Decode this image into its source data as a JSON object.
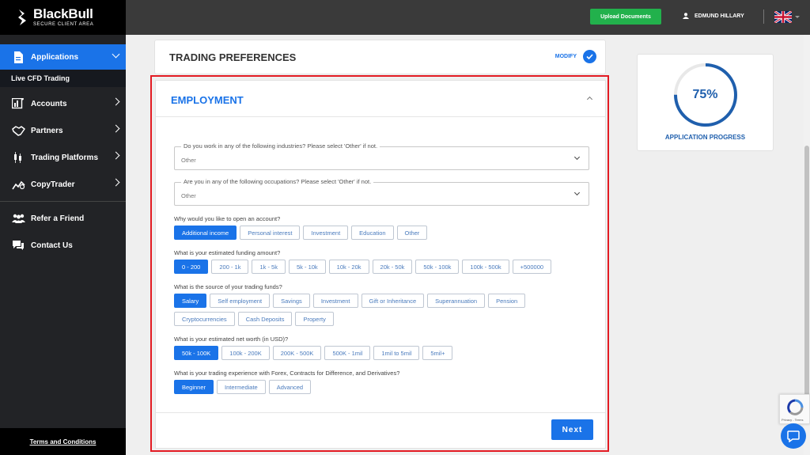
{
  "brand": {
    "name": "BlackBull",
    "tagline": "SECURE CLIENT AREA"
  },
  "sidebar": {
    "items": [
      {
        "label": "Applications",
        "icon": "document-icon"
      },
      {
        "label": "Live CFD Trading"
      },
      {
        "label": "Accounts",
        "icon": "accounts-icon"
      },
      {
        "label": "Partners",
        "icon": "handshake-icon"
      },
      {
        "label": "Trading Platforms",
        "icon": "candlestick-icon"
      },
      {
        "label": "CopyTrader",
        "icon": "copytrader-icon"
      },
      {
        "label": "Refer a Friend",
        "icon": "people-icon"
      },
      {
        "label": "Contact Us",
        "icon": "chat-icon"
      }
    ],
    "footer_link": "Terms and Conditions"
  },
  "topbar": {
    "upload_label": "Upload Documents",
    "user_name": "EDMUND HILLARY",
    "language_flag": "uk-flag-icon"
  },
  "trading_preferences": {
    "title": "TRADING PREFERENCES",
    "modify_label": "MODIFY"
  },
  "progress": {
    "value_label": "75%",
    "fraction": 0.75,
    "label": "APPLICATION PROGRESS",
    "color": "#1f5fad"
  },
  "employment": {
    "title": "EMPLOYMENT",
    "industries": {
      "legend": "Do you work in any of the following industries? Please select 'Other' if not.",
      "value": "Other"
    },
    "occupations": {
      "legend": "Are you in any of the following occupations? Please select 'Other' if not.",
      "value": "Other"
    },
    "reason": {
      "question": "Why would you like to open an account?",
      "options": [
        "Additional income",
        "Personal interest",
        "Investment",
        "Education",
        "Other"
      ],
      "selected": "Additional income"
    },
    "funding": {
      "question": "What is your estimated funding amount?",
      "options": [
        "0 - 200",
        "200 - 1k",
        "1k - 5k",
        "5k - 10k",
        "10k - 20k",
        "20k - 50k",
        "50k - 100k",
        "100k - 500k",
        "+500000"
      ],
      "selected": "0 - 200"
    },
    "source": {
      "question": "What is the source of your trading funds?",
      "options_row1": [
        "Salary",
        "Self employment",
        "Savings",
        "Investment",
        "Gift or Inheritance",
        "Superannuation",
        "Pension"
      ],
      "options_row2": [
        "Cryptocurrencies",
        "Cash Deposits",
        "Property"
      ],
      "selected": "Salary"
    },
    "net_worth": {
      "question": "What is your estimated net worth (in USD)?",
      "options": [
        "50k - 100K",
        "100k - 200K",
        "200K - 500K",
        "500K - 1mil",
        "1mil to 5mil",
        "5mil+"
      ],
      "selected": "50k - 100K"
    },
    "experience": {
      "question": "What is your trading experience with Forex, Contracts for Difference, and Derivatives?",
      "options": [
        "Beginner",
        "Intermediate",
        "Advanced"
      ],
      "selected": "Beginner"
    },
    "next_label": "Next"
  },
  "recaptcha_terms": "Privacy - Terms",
  "colors": {
    "accent": "#1a73e8",
    "highlight_border": "#e31b23",
    "upload": "#22b14c",
    "sidebar": "#222326"
  }
}
